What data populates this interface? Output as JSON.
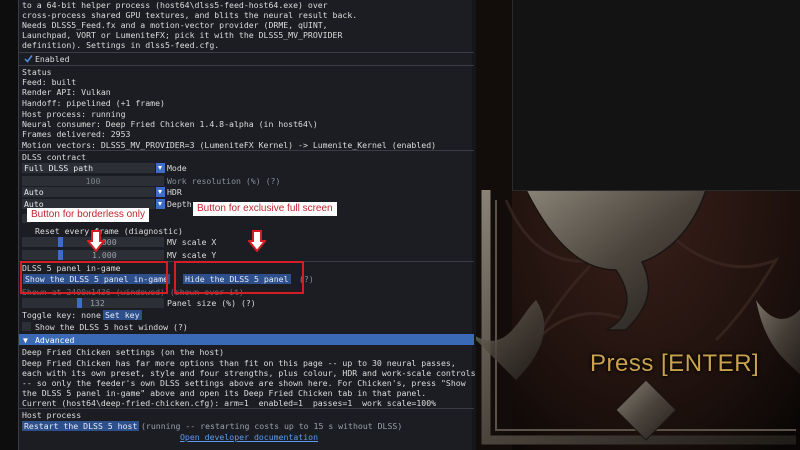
{
  "intro_lines": [
    "to a 64-bit helper process (host64\\dlss5-feed-host64.exe) over",
    "cross-process shared GPU textures, and blits the neural result back.",
    "Needs DLSS5_Feed.fx and a motion-vector provider (DRME, qUINT,",
    "Launchpad, VORT or LumeniteFX; pick it with the DLSS5_MV_PROVIDER",
    "definition). Settings in dlss5-feed.cfg."
  ],
  "enabled_label": "Enabled",
  "status": {
    "header": "Status",
    "lines": [
      "Feed: built",
      "Render API: Vulkan",
      "Handoff: pipelined (+1 frame)",
      "Host process: running",
      "Neural consumer: Deep Fried Chicken 1.4.8-alpha (in host64\\)",
      "Frames delivered: 2953",
      "Motion vectors: DLSS5_MV_PROVIDER=3 (LumeniteFX Kernel) -> Lumenite_Kernel (enabled)"
    ]
  },
  "contract": {
    "header": "DLSS contract",
    "mode_value": "Full DLSS path",
    "mode_label": "Mode",
    "work_res_value": "100",
    "work_res_label": "Work resolution (%) (?)",
    "hdr_value": "Auto",
    "hdr_label": "HDR",
    "depth_value": "Auto",
    "depth_label": "Depth",
    "reset_label": "Reset every frame (diagnostic)",
    "mv_x_value": "1.000",
    "mv_x_label": "MV scale X",
    "mv_y_value": "1.000",
    "mv_y_label": "MV scale Y"
  },
  "panel": {
    "header": "DLSS 5 panel in-game",
    "show_button": "Show the DLSS 5 panel in-game",
    "hide_button": "Hide the DLSS 5 panel",
    "help": "(?)",
    "shown_line": "Shown at 2400x1436 (windowed) (shown over it)",
    "size_value": "132",
    "size_label": "Panel size (%) (?)",
    "toggle_label": "Toggle key: none",
    "set_key": "Set key",
    "host_window": "Show the DLSS 5 host window (?)"
  },
  "advanced": {
    "header": "Advanced",
    "settings_header": "Deep Fried Chicken settings (on the host)",
    "lines": [
      "Deep Fried Chicken has far more options than fit on this page -- up to 30 neural passes,",
      "each with its own preset, style and four strengths, plus colour, HDR and work-scale controls",
      "-- so only the feeder's own DLSS settings above are shown here. For Chicken's, press \"Show",
      "the DLSS 5 panel in-game\" above and open its Deep Fried Chicken tab in that panel.",
      "Current (host64\\deep-fried-chicken.cfg): arm=1  enabled=1  passes=1  work scale=100%"
    ]
  },
  "host": {
    "header": "Host process",
    "restart_button": "Restart the DLSS 5 host",
    "restart_note": "(running -- restarting costs up to 15 s without DLSS)",
    "dev_link": "Open developer documentation"
  },
  "annotations": {
    "borderless": "Button for borderless only",
    "exclusive": "Button for exclusive full screen"
  },
  "game": {
    "prompt": "Press [ENTER]"
  },
  "colors": {
    "accent": "#3d6dc4",
    "annotation": "#d21e24",
    "prompt": "#c9a24e"
  }
}
